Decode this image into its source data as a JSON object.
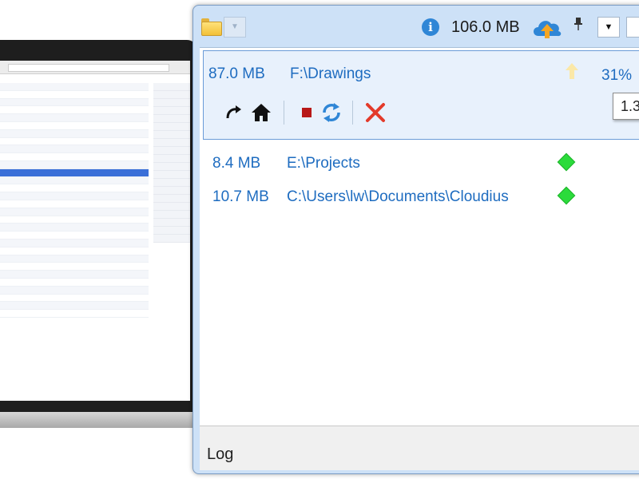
{
  "background_laptop": {
    "description_visible": "laptop screenshot behind app window"
  },
  "header": {
    "info_icon_glyph": "i",
    "total_size": "106.0 MB",
    "pin_glyph": "📌",
    "menu_glyph": "▼",
    "folder_icon": "folder-icon",
    "cloud_icon": "cloud-upload-icon"
  },
  "jobs": [
    {
      "size": "87.0 MB",
      "path": "F:\\Drawings",
      "percent": "31%",
      "tooltip": "1.3",
      "selected": true
    },
    {
      "size": "8.4 MB",
      "path": "E:\\Projects",
      "status_icon": "green-diamond-icon"
    },
    {
      "size": "10.7 MB",
      "path": "C:\\Users\\lw\\Documents\\Cloudius",
      "status_icon": "green-diamond-icon"
    }
  ],
  "toolbar": {
    "icons": [
      "redo-arrow-icon",
      "home-icon",
      "stop-icon",
      "sync-icon",
      "cancel-icon"
    ],
    "colors": {
      "stop": "#b81818",
      "sync": "#2f86d6",
      "cancel": "#e33a2a",
      "home": "#111111"
    }
  },
  "log": {
    "label": "Log"
  },
  "colors": {
    "accent": "#1e6cc0",
    "window_frame": "#cde1f7",
    "selection_border": "#6a9bd8",
    "status_ok": "#2bdb3b"
  }
}
